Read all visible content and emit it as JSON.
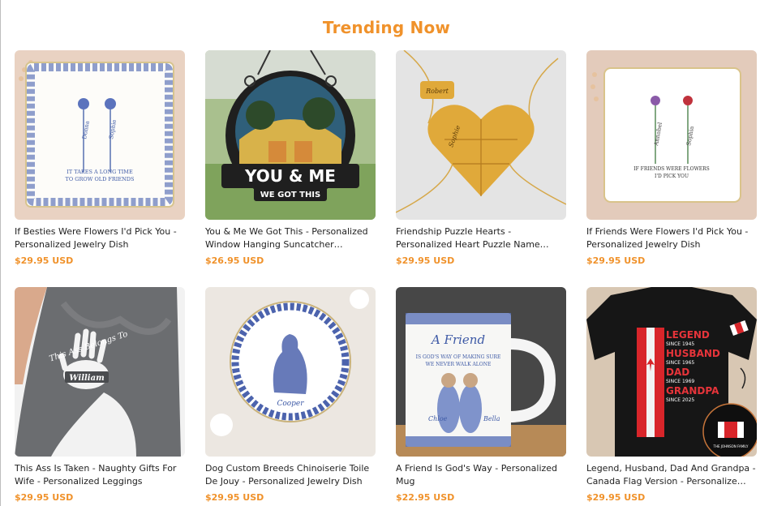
{
  "section": {
    "title": "Trending Now"
  },
  "colors": {
    "accent": "#f0922b"
  },
  "products": [
    {
      "name": "If Besties Were Flowers I'd Pick You - Personalized Jewelry Dish",
      "price": "$29.95 USD",
      "image": {
        "plate_text_1": "IT TAKES A LONG TIME",
        "plate_text_2": "TO GROW OLD FRIENDS",
        "name_1": "Donna",
        "name_2": "Sophie"
      }
    },
    {
      "name": "You & Me We Got This - Personalized Window Hanging Suncatcher…",
      "price": "$26.95 USD",
      "image": {
        "line_1": "YOU & ME",
        "line_2": "WE GOT THIS"
      }
    },
    {
      "name": "Friendship Puzzle Hearts - Personalized Heart Puzzle Name…",
      "price": "$29.95 USD",
      "image": {
        "name_1": "Robert",
        "name_2": "Sophie"
      }
    },
    {
      "name": "If Friends Were Flowers I'd Pick You - Personalized Jewelry Dish",
      "price": "$29.95 USD",
      "image": {
        "plate_text_1": "IF FRIENDS WERE FLOWERS",
        "plate_text_2": "I'D PICK YOU",
        "name_1": "Annabel",
        "name_2": "Sophia"
      }
    },
    {
      "name": "This Ass Is Taken - Naughty Gifts For Wife - Personalized Leggings",
      "price": "$29.95 USD",
      "image": {
        "script_text": "This Ass Belongs To",
        "name": "William"
      }
    },
    {
      "name": "Dog Custom Breeds Chinoiserie Toile De Jouy - Personalized Jewelry Dish",
      "price": "$29.95 USD",
      "image": {
        "name": "Cooper"
      }
    },
    {
      "name": "A Friend Is God's Way - Personalized Mug",
      "price": "$22.95 USD",
      "image": {
        "script_title": "A Friend",
        "line_1": "IS GOD'S WAY OF MAKING SURE",
        "line_2": "WE NEVER WALK ALONE",
        "name_1": "Chloe",
        "name_2": "Bella"
      }
    },
    {
      "name": "Legend, Husband, Dad And Grandpa - Canada Flag Version - Personalize…",
      "price": "$29.95 USD",
      "image": {
        "word_1": "LEGEND",
        "since_1": "SINCE 1945",
        "word_2": "HUSBAND",
        "since_2": "SINCE 1965",
        "word_3": "DAD",
        "since_3": "SINCE 1969",
        "word_4": "GRANDPA",
        "since_4": "SINCE 2025",
        "family": "THE JOHNSON FAMILY"
      }
    }
  ]
}
